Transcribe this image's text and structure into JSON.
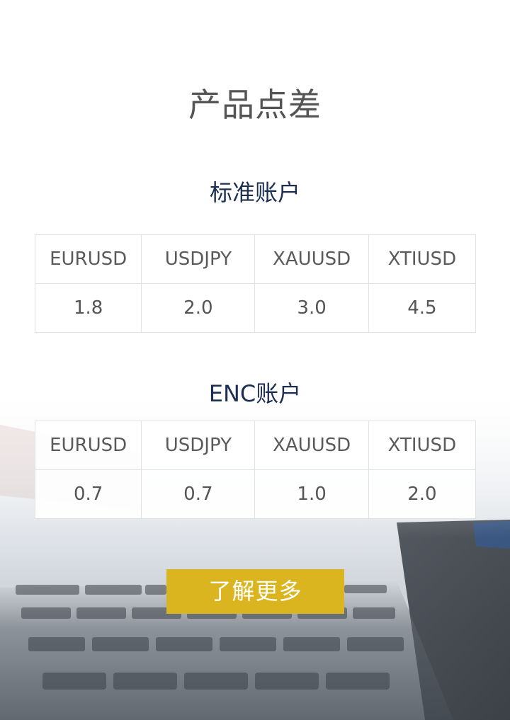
{
  "page": {
    "title": "产品点差"
  },
  "standard": {
    "title": "标准账户",
    "headers": [
      "EURUSD",
      "USDJPY",
      "XAUUSD",
      "XTIUSD"
    ],
    "values": [
      "1.8",
      "2.0",
      "3.0",
      "4.5"
    ]
  },
  "enc": {
    "title": "ENC账户",
    "headers": [
      "EURUSD",
      "USDJPY",
      "XAUUSD",
      "XTIUSD"
    ],
    "values": [
      "0.7",
      "0.7",
      "1.0",
      "2.0"
    ]
  },
  "cta": {
    "label": "了解更多"
  },
  "colors": {
    "button": "#dbb51f",
    "section_title": "#1c2f52",
    "text": "#555555",
    "border": "#e2e2e2"
  }
}
